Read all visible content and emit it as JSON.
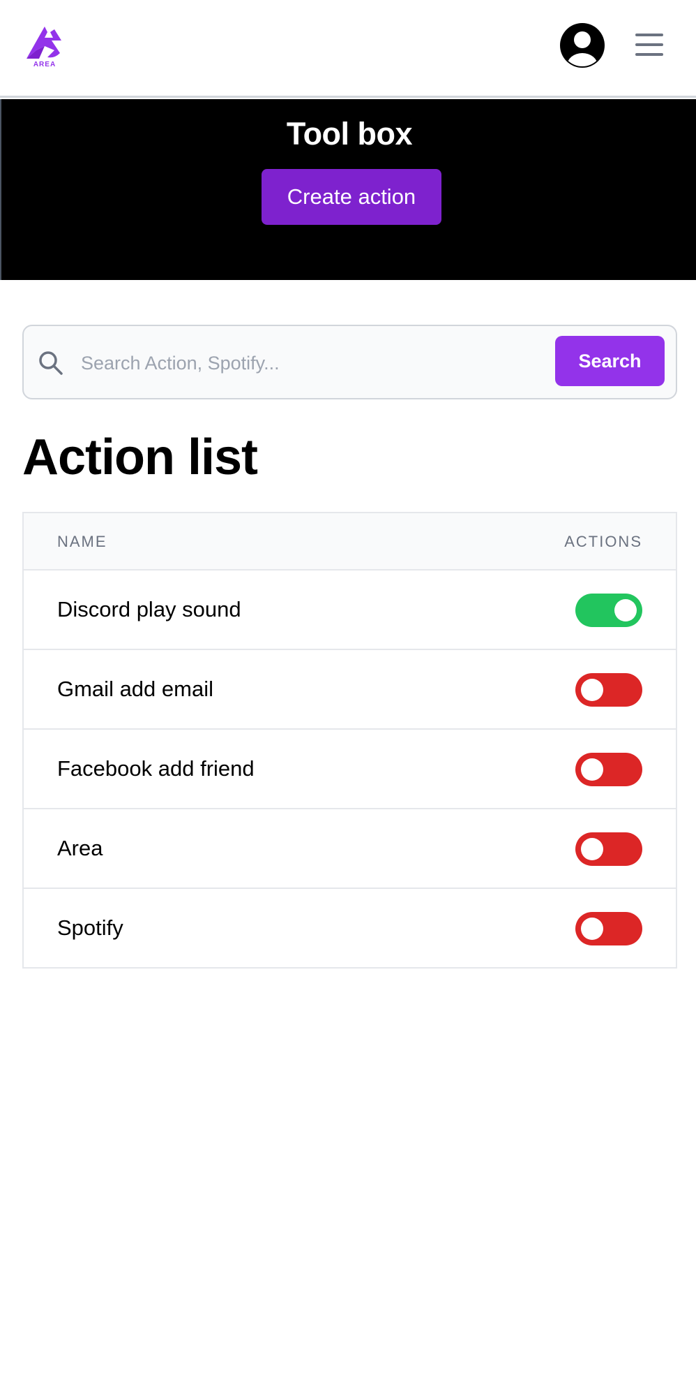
{
  "header": {
    "logo_text": "AREA",
    "brand_color": "#9333ea",
    "avatar_icon": "user-circle-icon",
    "menu_icon": "hamburger-menu-icon"
  },
  "hero": {
    "title": "Tool box",
    "create_button_label": "Create action",
    "button_color": "#7e22ce"
  },
  "search": {
    "placeholder": "Search Action, Spotify...",
    "value": "",
    "button_label": "Search",
    "icon": "search-icon"
  },
  "action_list": {
    "title": "Action list",
    "columns": [
      "NAME",
      "ACTIONS"
    ],
    "on_color": "#22c55e",
    "off_color": "#dc2626",
    "rows": [
      {
        "name": "Discord play sound",
        "enabled": true
      },
      {
        "name": "Gmail add email",
        "enabled": false
      },
      {
        "name": "Facebook add friend",
        "enabled": false
      },
      {
        "name": "Area",
        "enabled": false
      },
      {
        "name": "Spotify",
        "enabled": false
      }
    ]
  }
}
